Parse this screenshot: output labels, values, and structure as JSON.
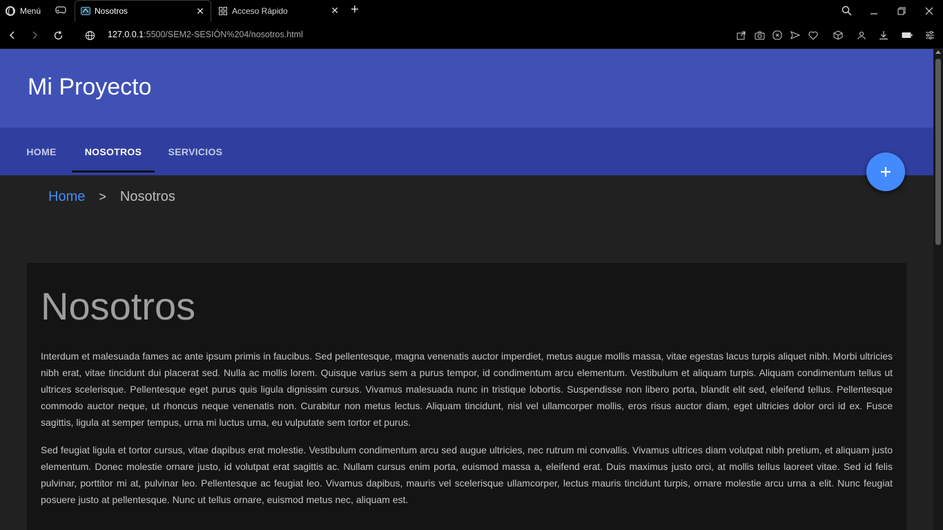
{
  "browser": {
    "menu_label": "Menú",
    "tabs": [
      {
        "label": "Nosotros",
        "active": true
      },
      {
        "label": "Acceso Rápido",
        "active": false
      }
    ],
    "url_host": "127.0.0.1",
    "url_path": ":5500/SEM2-SESIÓN%204/nosotros.html"
  },
  "site": {
    "title": "Mi Proyecto",
    "nav": [
      {
        "label": "HOME"
      },
      {
        "label": "NOSOTROS"
      },
      {
        "label": "SERVICIOS"
      }
    ],
    "fab_symbol": "+"
  },
  "breadcrumb": {
    "home": "Home",
    "separator": ">",
    "current": "Nosotros"
  },
  "content": {
    "heading": "Nosotros",
    "paragraphs": [
      "Interdum et malesuada fames ac ante ipsum primis in faucibus. Sed pellentesque, magna venenatis auctor imperdiet, metus augue mollis massa, vitae egestas lacus turpis aliquet nibh. Morbi ultricies nibh erat, vitae tincidunt dui placerat sed. Nulla ac mollis lorem. Quisque varius sem a purus tempor, id condimentum arcu elementum. Vestibulum et aliquam turpis. Aliquam condimentum tellus ut ultrices scelerisque. Pellentesque eget purus quis ligula dignissim cursus. Vivamus malesuada nunc in tristique lobortis. Suspendisse non libero porta, blandit elit sed, eleifend tellus. Pellentesque commodo auctor neque, ut rhoncus neque venenatis non. Curabitur non metus lectus. Aliquam tincidunt, nisl vel ullamcorper mollis, eros risus auctor diam, eget ultricies dolor orci id ex. Fusce sagittis, ligula at semper tempus, urna mi luctus urna, eu vulputate sem tortor et purus.",
      "Sed feugiat ligula et tortor cursus, vitae dapibus erat molestie. Vestibulum condimentum arcu sed augue ultricies, nec rutrum mi convallis. Vivamus ultrices diam volutpat nibh pretium, et aliquam justo elementum. Donec molestie ornare justo, id volutpat erat sagittis ac. Nullam cursus enim porta, euismod massa a, eleifend erat. Duis maximus justo orci, at mollis tellus laoreet vitae. Sed id felis pulvinar, porttitor mi at, pulvinar leo. Pellentesque ac feugiat leo. Vivamus dapibus, mauris vel scelerisque ullamcorper, lectus mauris tincidunt turpis, ornare molestie arcu urna a elit. Nunc feugiat posuere justo at pellentesque. Nunc ut tellus ornare, euismod metus nec, aliquam est."
    ]
  },
  "colors": {
    "header_bg": "#3f51b5",
    "nav_bg": "#303f9f",
    "accent": "#448aff",
    "page_bg": "#212121",
    "card_bg": "#141414"
  }
}
